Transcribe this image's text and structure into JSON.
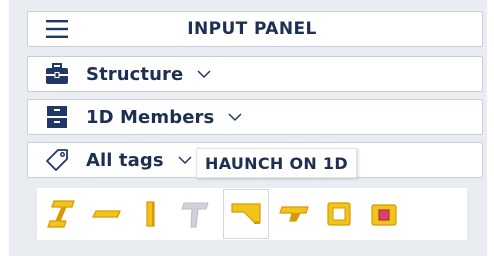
{
  "header": {
    "title": "INPUT PANEL",
    "menu_icon": "hamburger-menu-icon"
  },
  "sections": [
    {
      "label": "Structure",
      "icon": "toolbox-icon",
      "expanded": false
    },
    {
      "label": "1D Members",
      "icon": "cabinet-icon",
      "expanded": false
    },
    {
      "label": "All tags",
      "icon": "tag-icon",
      "expanded": false
    }
  ],
  "tooltip": {
    "text": "HAUNCH ON 1D"
  },
  "toolbar": {
    "tools": [
      {
        "icon": "steel-beam-icon",
        "state": "enabled"
      },
      {
        "icon": "horizontal-member-icon",
        "state": "enabled"
      },
      {
        "icon": "column-member-icon",
        "state": "enabled"
      },
      {
        "icon": "tapered-member-icon",
        "state": "disabled"
      },
      {
        "icon": "haunch-on-1d-icon",
        "state": "active"
      },
      {
        "icon": "haunch-variant-icon",
        "state": "enabled"
      },
      {
        "icon": "hollow-square-section-icon",
        "state": "enabled"
      },
      {
        "icon": "square-tube-section-icon",
        "state": "enabled"
      }
    ]
  },
  "colors": {
    "text": "#1d2f52",
    "icon_blue": "#1f3867",
    "tool_yellow": "#f0c419",
    "tool_orange": "#d89a00",
    "disabled": "#b9bec6"
  }
}
